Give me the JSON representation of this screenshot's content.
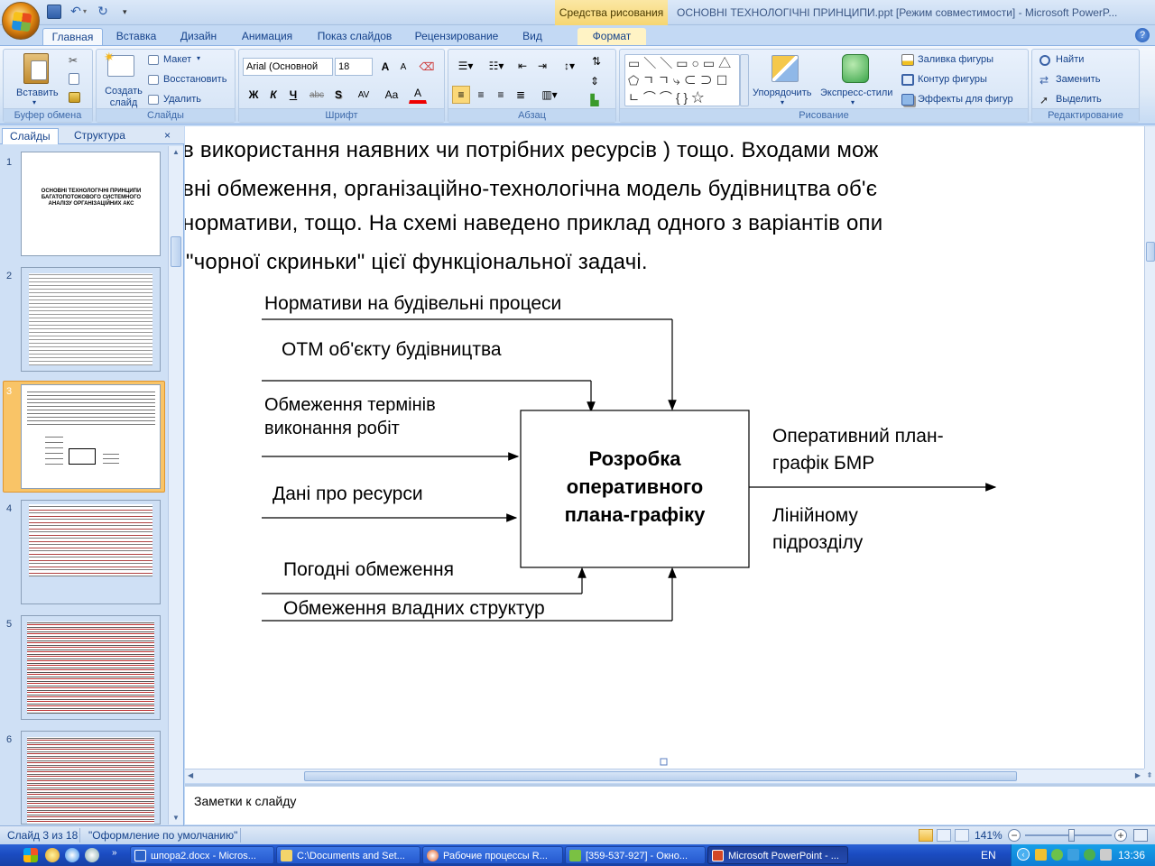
{
  "window": {
    "title": "ОСНОВНІ ТЕХНОЛОГІЧНІ ПРИНЦИПИ.ppt [Режим совместимости] - Microsoft PowerP...",
    "context_tab_group": "Средства рисования"
  },
  "tabs": [
    "Главная",
    "Вставка",
    "Дизайн",
    "Анимация",
    "Показ слайдов",
    "Рецензирование",
    "Вид",
    "Формат"
  ],
  "ribbon": {
    "clipboard": {
      "paste": "Вставить",
      "title": "Буфер обмена"
    },
    "slides": {
      "new_slide": "Создать слайд",
      "layout": "Макет",
      "reset": "Восстановить",
      "delete": "Удалить",
      "title": "Слайды"
    },
    "font": {
      "font_name": "Arial (Основной",
      "font_size": "18",
      "bold": "Ж",
      "italic": "К",
      "underline": "Ч",
      "strike": "abc",
      "shadow": "S",
      "spacing": "AV",
      "case": "Aa",
      "color": "A",
      "grow": "A",
      "shrink": "A",
      "title": "Шрифт"
    },
    "paragraph": {
      "title": "Абзац"
    },
    "drawing": {
      "arrange": "Упорядочить",
      "quick_styles": "Экспресс-стили",
      "fill": "Заливка фигуры",
      "outline": "Контур фигуры",
      "effects": "Эффекты для фигур",
      "title": "Рисование"
    },
    "editing": {
      "find": "Найти",
      "replace": "Заменить",
      "select": "Выделить",
      "title": "Редактирование"
    }
  },
  "pane": {
    "tab_slides": "Слайды",
    "tab_outline": "Структура",
    "close": "×",
    "slide_numbers": [
      "1",
      "2",
      "3",
      "4",
      "5",
      "6"
    ],
    "slide1_title": "ОСНОВНІ ТЕХНОЛОГІЧНІ ПРИНЦИПИ БАГАТОПОТОКОВОГО СИСТЕМНОГО АНАЛІЗУ ОРГАНІЗАЦІЙНИХ АКС"
  },
  "slide": {
    "paragraph_lines": [
      "в використання наявних чи потрібних ресурсів ) тощо. Входами мож",
      "вні обмеження, організаційно-технологічна модель будівництва об'є",
      "нормативи, тощо. На схемі наведено приклад одного з варіантів опи",
      "\"чорної скриньки\" цієї функціональної задачі."
    ],
    "diagram": {
      "input1": "Нормативи на будівельні процеси",
      "input2": "ОТМ об'єкту будівництва",
      "input3a": "Обмеження термінів",
      "input3b": "виконання робіт",
      "input4": "Дані про ресурси",
      "input5": "Погодні обмеження",
      "input6": "Обмеження владних структур",
      "box_line1": "Розробка",
      "box_line2": "оперативного",
      "box_line3": "плана-графіку",
      "out1a": "Оперативний план-",
      "out1b": "графік БМР",
      "out2a": "Лінійному",
      "out2b": "підрозділу"
    }
  },
  "notes": {
    "placeholder": "Заметки к слайду"
  },
  "status": {
    "slide_of": "Слайд 3 из 18",
    "theme": "\"Оформление по умолчанию\"",
    "zoom": "141%"
  },
  "taskbar": {
    "items": [
      "шпора2.docx - Micros...",
      "C:\\Documents and Set...",
      "Рабочие процессы R...",
      "[359-537-927] - Окно...",
      "Microsoft PowerPoint - ..."
    ],
    "lang": "EN",
    "clock": "13:36"
  }
}
